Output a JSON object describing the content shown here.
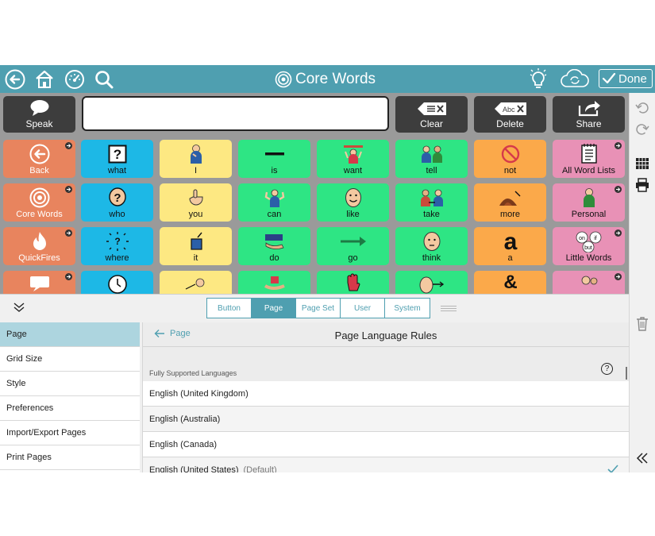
{
  "topbar": {
    "title": "Core Words",
    "done_label": "Done",
    "icons": [
      "back-arrow-icon",
      "home-icon",
      "dashboard-icon",
      "search-icon",
      "lightbulb-icon",
      "cloud-sync-icon"
    ],
    "bar_color": "#4f9fb0"
  },
  "action_buttons": {
    "speak": "Speak",
    "clear": "Clear",
    "delete": "Delete",
    "share": "Share",
    "delete_icon_text": "Abc"
  },
  "grid": {
    "rows": [
      [
        "Back",
        "what",
        "I",
        "is",
        "want",
        "tell",
        "not",
        "All Word Lists"
      ],
      [
        "Core Words",
        "who",
        "you",
        "can",
        "like",
        "take",
        "more",
        "Personal"
      ],
      [
        "QuickFires",
        "where",
        "it",
        "do",
        "go",
        "think",
        "a",
        "Little Words"
      ]
    ],
    "symbol_glyphs": {
      "what": "?",
      "who": "?",
      "a": "a",
      "amp": "&",
      "little_on": "on",
      "little_if": "if",
      "little_but": "but"
    },
    "colors": {
      "nav": "#e8845e",
      "question": "#1db8e6",
      "pronoun": "#fde882",
      "verb": "#2ee584",
      "misc": "#fba94a",
      "folder": "#e891b6"
    }
  },
  "editor": {
    "tabs": [
      "Button",
      "Page",
      "Page Set",
      "User",
      "System"
    ],
    "active_tab": "Page",
    "sidebar": [
      "Page",
      "Grid Size",
      "Style",
      "Preferences",
      "Import/Export Pages",
      "Print Pages"
    ],
    "active_sidebar": "Page",
    "back_label": "Page",
    "panel_title": "Page Language Rules",
    "section_label": "Fully Supported Languages",
    "help_glyph": "?",
    "languages": [
      {
        "name": "English (United Kingdom)",
        "default": ""
      },
      {
        "name": "English (Australia)",
        "default": ""
      },
      {
        "name": "English (Canada)",
        "default": ""
      },
      {
        "name": "English (United States)",
        "default": "(Default)"
      }
    ]
  }
}
